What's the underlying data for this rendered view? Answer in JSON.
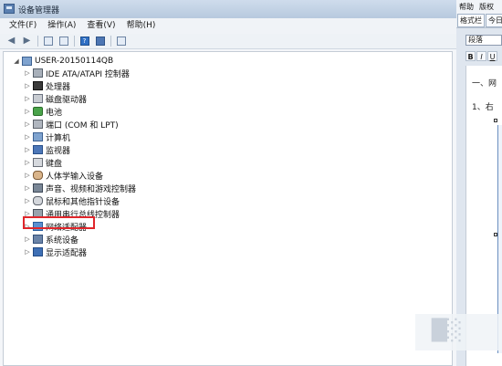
{
  "window": {
    "title": "设备管理器"
  },
  "menu": {
    "items": [
      "文件(F)",
      "操作(A)",
      "查看(V)",
      "帮助(H)"
    ]
  },
  "tree": {
    "root": "USER-20150114QB",
    "items": [
      {
        "label": "IDE ATA/ATAPI 控制器",
        "icon": "ide-controller-icon"
      },
      {
        "label": "处理器",
        "icon": "processor-icon"
      },
      {
        "label": "磁盘驱动器",
        "icon": "disk-drive-icon"
      },
      {
        "label": "电池",
        "icon": "battery-icon"
      },
      {
        "label": "端口 (COM 和 LPT)",
        "icon": "port-icon"
      },
      {
        "label": "计算机",
        "icon": "computer-icon"
      },
      {
        "label": "监视器",
        "icon": "monitor-icon"
      },
      {
        "label": "键盘",
        "icon": "keyboard-icon"
      },
      {
        "label": "人体学输入设备",
        "icon": "hid-icon"
      },
      {
        "label": "声音、视频和游戏控制器",
        "icon": "sound-icon"
      },
      {
        "label": "鼠标和其他指针设备",
        "icon": "mouse-icon"
      },
      {
        "label": "通用串行总线控制器",
        "icon": "usb-icon"
      },
      {
        "label": "网络适配器",
        "icon": "network-adapter-icon"
      },
      {
        "label": "系统设备",
        "icon": "system-device-icon"
      },
      {
        "label": "显示适配器",
        "icon": "display-adapter-icon"
      }
    ],
    "highlighted": "网络适配器",
    "highlight_color": "#e0262b"
  },
  "word": {
    "menu": [
      "帮助",
      "版权"
    ],
    "tabs": [
      "格式栏",
      "今日"
    ],
    "style_value": "段落",
    "format_buttons": [
      "B",
      "I",
      "U"
    ],
    "doc_lines": [
      "一、网",
      "1、右"
    ]
  }
}
